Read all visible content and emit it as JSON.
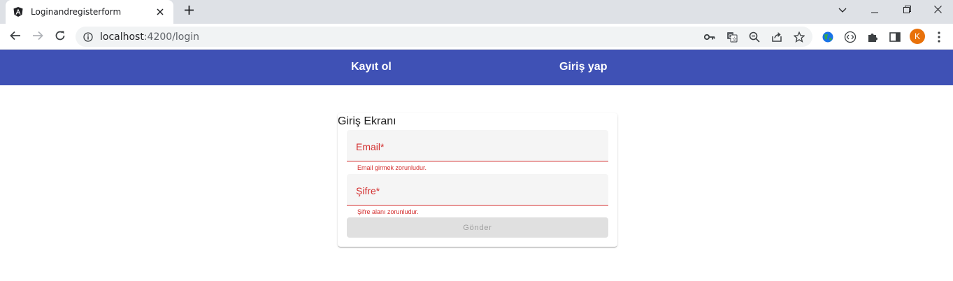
{
  "browser": {
    "tab_title": "Loginandregisterform",
    "url_host": "localhost",
    "url_path": ":4200/login",
    "avatar_letter": "K"
  },
  "icons": {
    "tab_favicon": "angular-icon",
    "tab_close": "close-icon",
    "new_tab": "plus-icon",
    "tab_search": "chevron-down-icon",
    "minimize": "minimize-icon",
    "restore": "restore-icon",
    "close_window": "close-icon",
    "back": "arrow-left-icon",
    "forward": "arrow-right-icon",
    "reload": "reload-icon",
    "site_info": "info-icon",
    "password_key": "key-icon",
    "translate": "translate-icon",
    "zoom": "zoom-out-icon",
    "share": "share-icon",
    "bookmark": "star-icon",
    "extensions": "puzzle-icon",
    "side_panel": "side-panel-icon",
    "menu": "kebab-menu-icon"
  },
  "colors": {
    "primary": "#3f51b5",
    "error": "#d32f2f",
    "avatar": "#e8710a"
  },
  "nav": {
    "register": "Kayıt ol",
    "login": "Giriş yap"
  },
  "login_card": {
    "title": "Giriş Ekranı",
    "email_label": "Email*",
    "email_value": "",
    "email_error": "Email girmek zorunludur.",
    "password_label": "Şifre*",
    "password_value": "",
    "password_error": "Şifre alanı zorunludur.",
    "submit_label": "Gönder"
  }
}
